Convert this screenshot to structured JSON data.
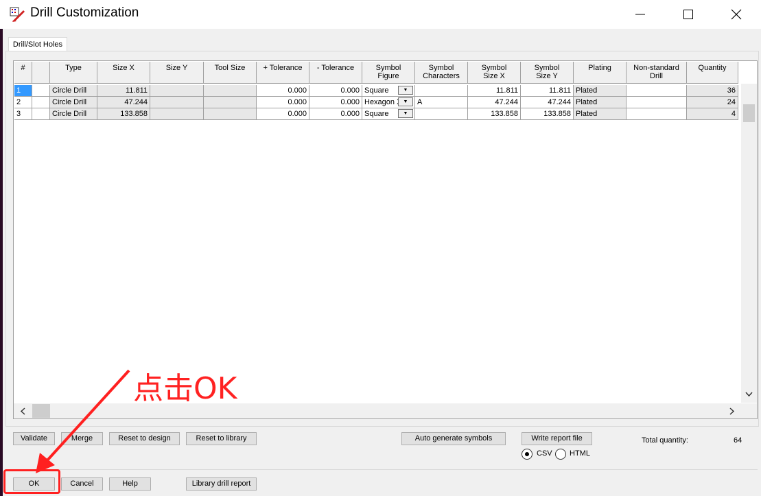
{
  "window": {
    "title": "Drill Customization",
    "icon": "drill-app-icon",
    "controls": [
      "minimize-icon",
      "maximize-icon",
      "close-icon"
    ]
  },
  "tab": {
    "label": "Drill/Slot Holes"
  },
  "table": {
    "headers": [
      "#",
      "",
      "Type",
      "Size X",
      "Size Y",
      "Tool Size",
      "+ Tolerance",
      "- Tolerance",
      "Symbol\nFigure",
      "Symbol\nCharacters",
      "Symbol\nSize X",
      "Symbol\nSize Y",
      "Plating",
      "Non-standard\nDrill",
      "Quantity"
    ],
    "rows": [
      {
        "num": "1",
        "type": "Circle Drill",
        "size_x": "11.811",
        "size_y": "",
        "tool_size": "",
        "plus_tol": "0.000",
        "minus_tol": "0.000",
        "figure": "Square",
        "chars": "",
        "sym_x": "11.811",
        "sym_y": "11.811",
        "plating": "Plated",
        "nonstd": "",
        "qty": "36"
      },
      {
        "num": "2",
        "type": "Circle Drill",
        "size_x": "47.244",
        "size_y": "",
        "tool_size": "",
        "plus_tol": "0.000",
        "minus_tol": "0.000",
        "figure": "Hexagon X",
        "chars": "A",
        "sym_x": "47.244",
        "sym_y": "47.244",
        "plating": "Plated",
        "nonstd": "",
        "qty": "24"
      },
      {
        "num": "3",
        "type": "Circle Drill",
        "size_x": "133.858",
        "size_y": "",
        "tool_size": "",
        "plus_tol": "0.000",
        "minus_tol": "0.000",
        "figure": "Square",
        "chars": "",
        "sym_x": "133.858",
        "sym_y": "133.858",
        "plating": "Plated",
        "nonstd": "",
        "qty": "4"
      }
    ]
  },
  "buttons": {
    "validate": "Validate",
    "merge": "Merge",
    "reset_design": "Reset to design",
    "reset_library": "Reset to library",
    "auto_generate": "Auto generate symbols",
    "write_report": "Write report file",
    "ok": "OK",
    "cancel": "Cancel",
    "help": "Help",
    "library_report": "Library drill report"
  },
  "report_format": {
    "csv": "CSV",
    "html": "HTML",
    "selected": "CSV"
  },
  "total": {
    "label": "Total quantity:",
    "value": "64"
  },
  "annotation": {
    "text": "点击OK",
    "color": "#ff2222"
  }
}
